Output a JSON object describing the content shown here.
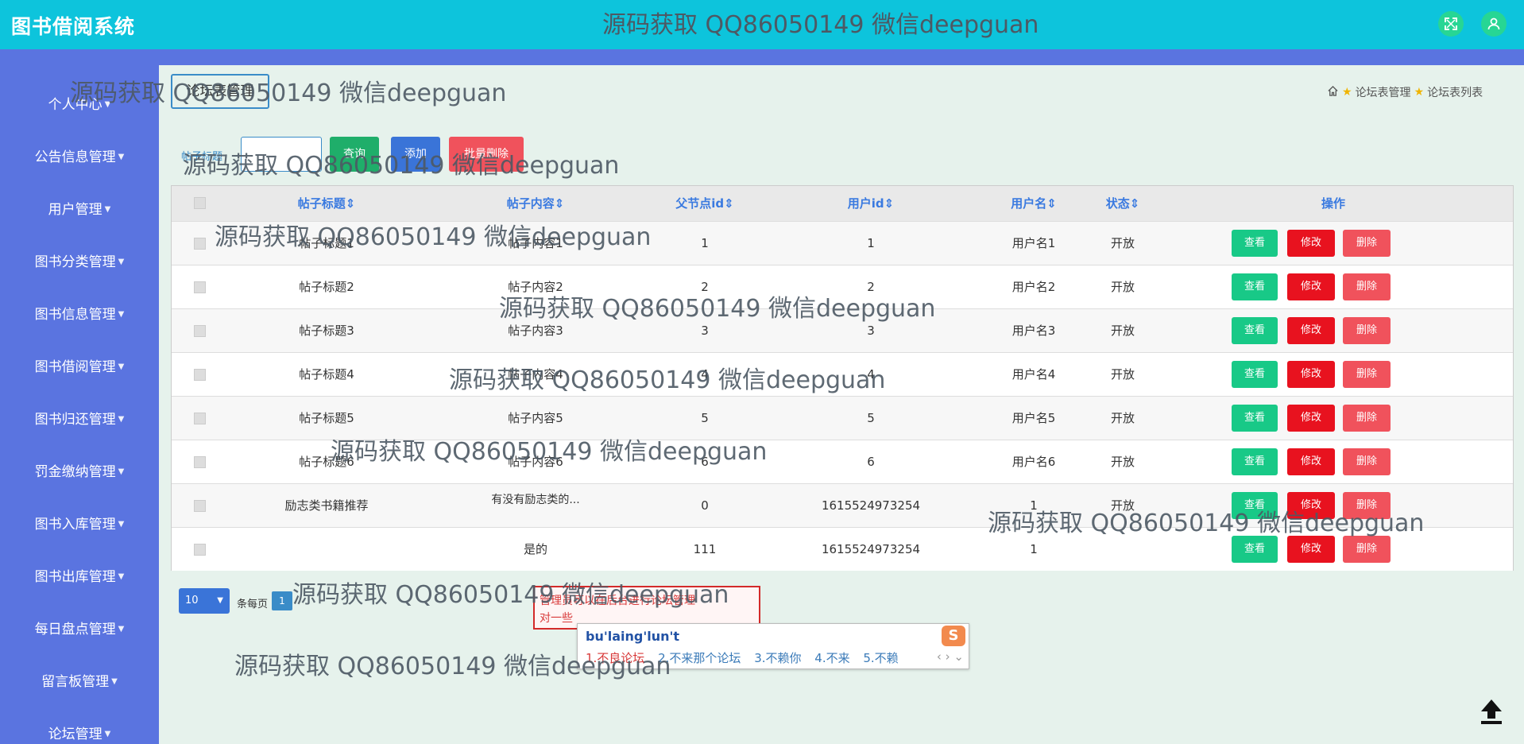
{
  "header": {
    "title": "图书借阅系统",
    "watermark": "源码获取 QQ86050149 微信deepguan",
    "fullscreen_icon": "expand-icon",
    "user_icon": "user-icon"
  },
  "sidebar": {
    "items": [
      {
        "label": "个人中心"
      },
      {
        "label": "公告信息管理"
      },
      {
        "label": "用户管理"
      },
      {
        "label": "图书分类管理"
      },
      {
        "label": "图书信息管理"
      },
      {
        "label": "图书借阅管理"
      },
      {
        "label": "图书归还管理"
      },
      {
        "label": "罚金缴纳管理"
      },
      {
        "label": "图书入库管理"
      },
      {
        "label": "图书出库管理"
      },
      {
        "label": "每日盘点管理"
      },
      {
        "label": "留言板管理"
      },
      {
        "label": "论坛管理"
      }
    ]
  },
  "breadcrumb": {
    "box_label": "论坛表管理",
    "home_icon": "home-icon",
    "path": [
      "论坛表管理",
      "论坛表列表"
    ]
  },
  "search": {
    "label": "帖子标题",
    "value": "",
    "query_button": "查询",
    "add_button": "添加",
    "batch_delete_button": "批量删除"
  },
  "table": {
    "columns": [
      "帖子标题",
      "帖子内容",
      "父节点id",
      "用户id",
      "用户名",
      "状态",
      "操作"
    ],
    "action_labels": {
      "view": "查看",
      "edit": "修改",
      "delete": "删除"
    },
    "rows": [
      {
        "title": "帖子标题1",
        "content": "帖子内容1",
        "parentid": "1",
        "userid": "1",
        "username": "用户名1",
        "status": "开放"
      },
      {
        "title": "帖子标题2",
        "content": "帖子内容2",
        "parentid": "2",
        "userid": "2",
        "username": "用户名2",
        "status": "开放"
      },
      {
        "title": "帖子标题3",
        "content": "帖子内容3",
        "parentid": "3",
        "userid": "3",
        "username": "用户名3",
        "status": "开放"
      },
      {
        "title": "帖子标题4",
        "content": "帖子内容4",
        "parentid": "4",
        "userid": "4",
        "username": "用户名4",
        "status": "开放"
      },
      {
        "title": "帖子标题5",
        "content": "帖子内容5",
        "parentid": "5",
        "userid": "5",
        "username": "用户名5",
        "status": "开放"
      },
      {
        "title": "帖子标题6",
        "content": "帖子内容6",
        "parentid": "6",
        "userid": "6",
        "username": "用户名6",
        "status": "开放"
      },
      {
        "title": "励志类书籍推荐",
        "content": "有没有励志类的...",
        "parentid": "0",
        "userid": "1615524973254",
        "username": "1",
        "status": "开放"
      },
      {
        "title": "",
        "content": "是的",
        "parentid": "111",
        "userid": "1615524973254",
        "username": "1",
        "status": ""
      }
    ]
  },
  "pagination": {
    "page_size": "10",
    "per_page_label": "条每页",
    "current_page": "1"
  },
  "tooltip": {
    "line1": "管理员可以在后台进行论坛管理",
    "line2": "对一些"
  },
  "ime": {
    "composition": "bu'laing'lun't",
    "candidates": [
      "1.不良论坛",
      "2.不来那个论坛",
      "3.不赖你",
      "4.不来",
      "5.不赖"
    ],
    "logo": "S",
    "nav": "‹ › ⌄"
  },
  "back_to_top_icon": "arrow-up-icon"
}
